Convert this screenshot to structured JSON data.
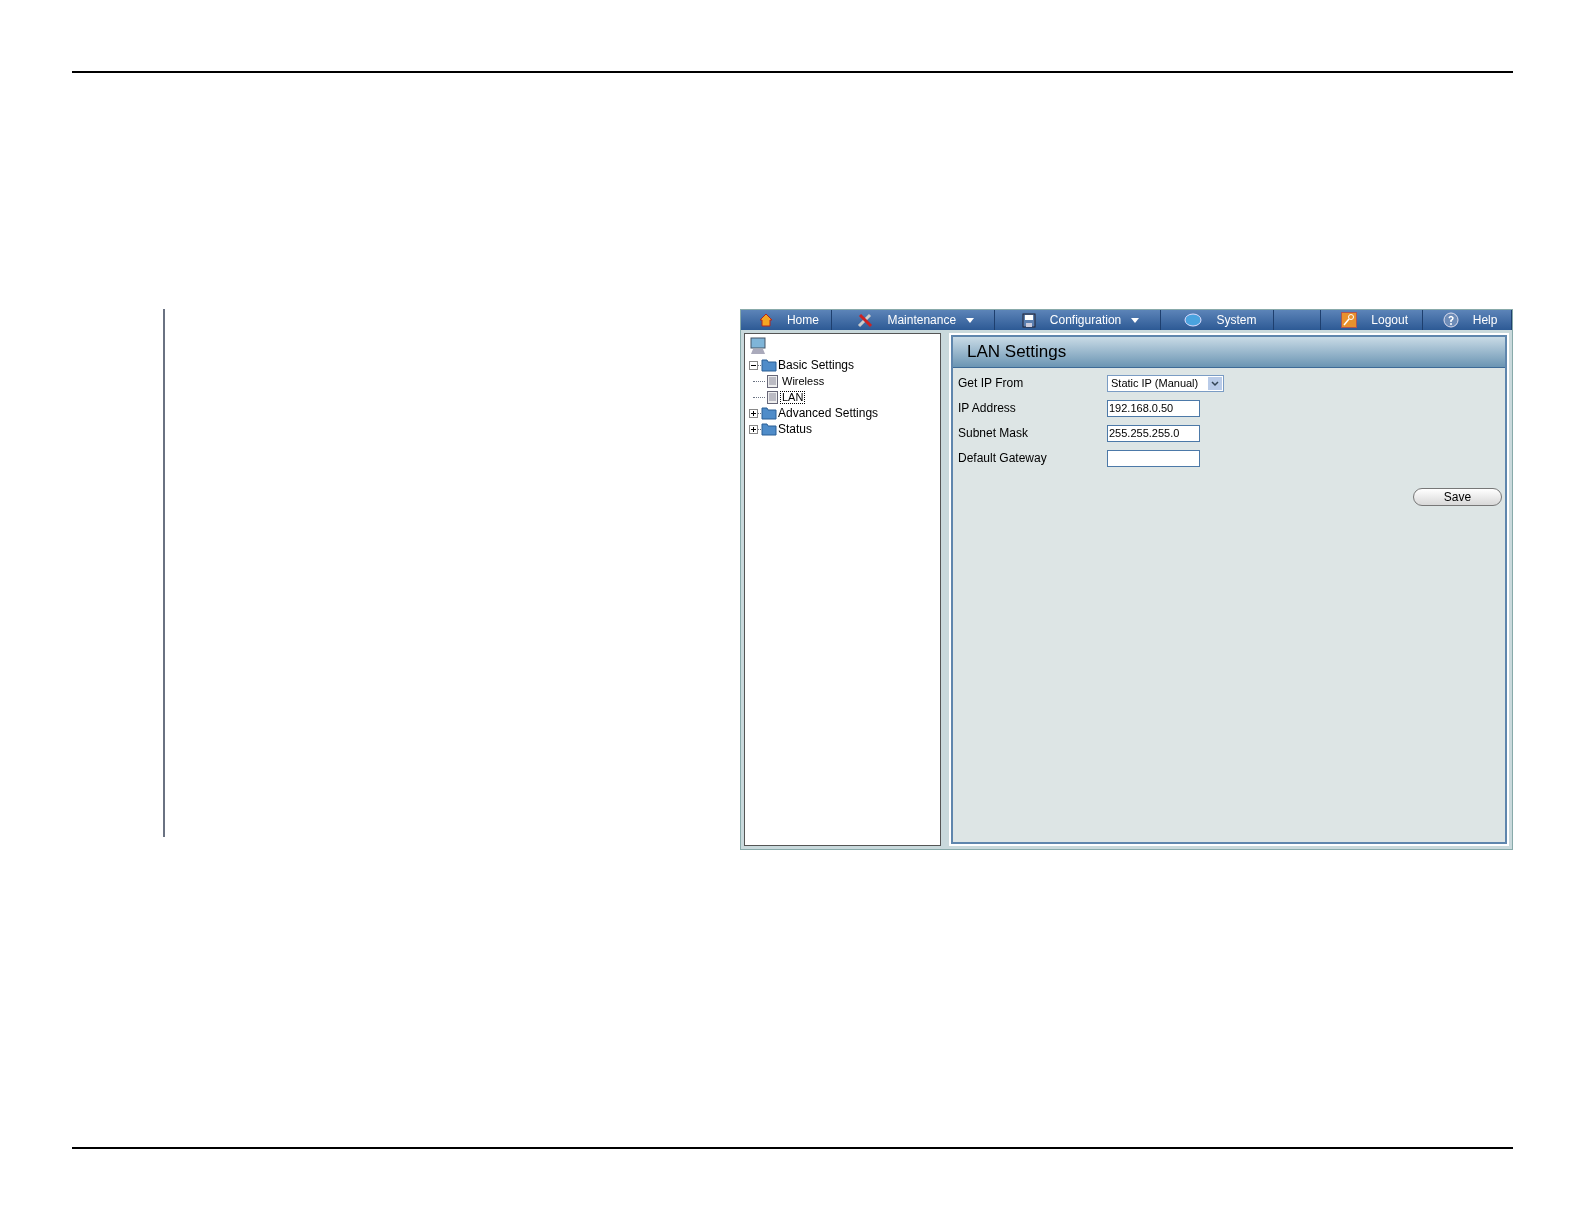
{
  "menu": [
    {
      "kind": "home",
      "label": "Home",
      "dropdown": false
    },
    {
      "kind": "maintenance",
      "label": "Maintenance",
      "dropdown": true
    },
    {
      "kind": "configuration",
      "label": "Configuration",
      "dropdown": true
    },
    {
      "kind": "system",
      "label": "System",
      "dropdown": false
    },
    {
      "kind": "spacer"
    },
    {
      "kind": "logout",
      "label": "Logout",
      "dropdown": false
    },
    {
      "kind": "help",
      "label": "Help",
      "dropdown": false
    }
  ],
  "tree": [
    {
      "label": "Basic Settings",
      "expanded": true,
      "children": [
        {
          "label": "Wireless",
          "selected": false
        },
        {
          "label": "LAN",
          "selected": true
        }
      ]
    },
    {
      "label": "Advanced Settings",
      "expanded": false
    },
    {
      "label": "Status",
      "expanded": false
    }
  ],
  "panel": {
    "title": "LAN Settings",
    "fields": [
      {
        "kind": "select",
        "label": "Get IP From",
        "value": "Static IP (Manual)"
      },
      {
        "kind": "text",
        "label": "IP Address",
        "value": "192.168.0.50"
      },
      {
        "kind": "text",
        "label": "Subnet Mask",
        "value": "255.255.255.0"
      },
      {
        "kind": "text",
        "label": "Default Gateway"
      }
    ],
    "save_button": "Save"
  }
}
